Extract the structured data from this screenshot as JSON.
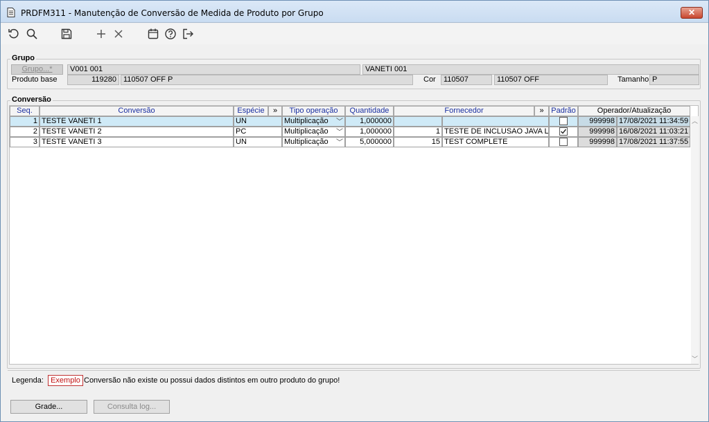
{
  "window": {
    "title": "PRDFM311 - Manutenção de Conversão de Medida de Produto por Grupo",
    "close_label": "✕"
  },
  "toolbar": {
    "items": [
      "refresh-icon",
      "search-icon",
      "save-icon",
      "add-icon",
      "delete-icon",
      "calendar-icon",
      "help-icon",
      "exit-icon"
    ]
  },
  "grupo": {
    "legend": "Grupo",
    "button_label": "Grupo...*",
    "code": "V001 001",
    "name": "VANETI 001",
    "produto_label": "Produto base",
    "produto_code": "119280",
    "produto_desc": "110507 OFF P",
    "cor_label": "Cor",
    "cor_code": "110507",
    "cor_desc": "110507 OFF",
    "tamanho_label": "Tamanho",
    "tamanho_value": "P"
  },
  "conversao": {
    "legend": "Conversão",
    "headers": {
      "seq": "Seq.",
      "conversao": "Conversão",
      "especie": "Espécie",
      "especie_more": "»",
      "tipo": "Tipo operação",
      "quantidade": "Quantidade",
      "fornecedor": "Fornecedor",
      "fornecedor_more": "»",
      "padrao": "Padrão",
      "operador": "Operador/Atualização"
    },
    "rows": [
      {
        "seq": "1",
        "conversao": "TESTE VANETI 1",
        "especie": "UN",
        "tipo": "Multiplicação",
        "quantidade": "1,000000",
        "forn_code": "",
        "forn_name": "",
        "padrao": false,
        "operador": "999998",
        "data": "17/08/2021 11:34:59"
      },
      {
        "seq": "2",
        "conversao": "TESTE VANETI 2",
        "especie": "PC",
        "tipo": "Multiplicação",
        "quantidade": "1,000000",
        "forn_code": "1",
        "forn_name": "TESTE DE INCLUSAO JAVA LEO",
        "padrao": true,
        "operador": "999998",
        "data": "16/08/2021 11:03:21"
      },
      {
        "seq": "3",
        "conversao": "TESTE VANETI 3",
        "especie": "UN",
        "tipo": "Multiplicação",
        "quantidade": "5,000000",
        "forn_code": "15",
        "forn_name": "TEST COMPLETE",
        "padrao": false,
        "operador": "999998",
        "data": "17/08/2021 11:37:55"
      }
    ]
  },
  "legenda": {
    "label": "Legenda:",
    "sample": "Exemplo",
    "text": "Conversão não existe ou possui dados distintos em outro produto do grupo!"
  },
  "buttons": {
    "grade": "Grade...",
    "consulta_log": "Consulta log..."
  },
  "colors": {
    "selected_row": "#cfeaf7",
    "header_text": "#1a2fa0",
    "legend_red": "#c01010"
  }
}
